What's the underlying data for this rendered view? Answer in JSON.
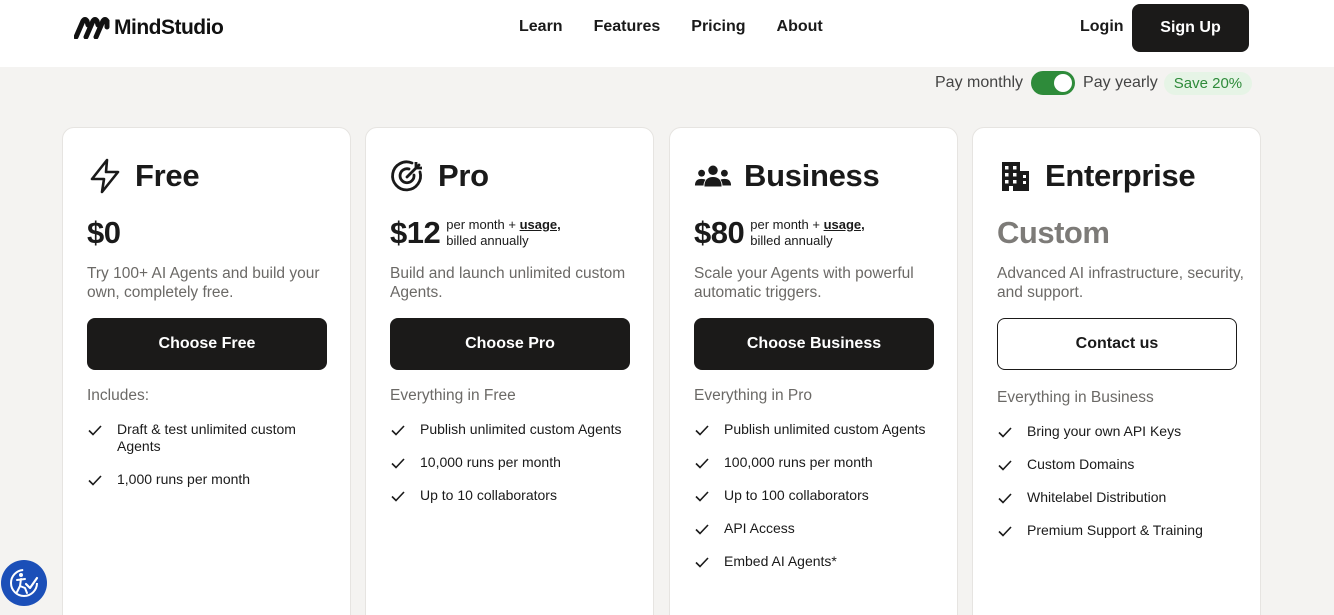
{
  "header": {
    "brand": "MindStudio",
    "nav": [
      "Learn",
      "Features",
      "Pricing",
      "About"
    ],
    "login": "Login",
    "signup": "Sign Up"
  },
  "billing": {
    "monthly": "Pay monthly",
    "yearly": "Pay yearly",
    "save": "Save 20%",
    "yearly_selected": true
  },
  "plans": [
    {
      "name": "Free",
      "icon": "lightning-icon",
      "price": "$0",
      "note_line1": "",
      "note_usage": "",
      "note_line2": "",
      "description": "Try 100+ AI Agents and build your own, completely free.",
      "cta": "Choose Free",
      "includes": "Includes:",
      "features": [
        "Draft & test unlimited custom Agents",
        "1,000 runs per month"
      ]
    },
    {
      "name": "Pro",
      "icon": "target-icon",
      "price": "$12",
      "note_line1": "per month + ",
      "note_usage": "usage,",
      "note_line2": "billed annually",
      "description": "Build and launch unlimited custom Agents.",
      "cta": "Choose Pro",
      "includes": "Everything in Free",
      "features": [
        "Publish unlimited custom Agents",
        "10,000 runs per month",
        "Up to 10 collaborators"
      ]
    },
    {
      "name": "Business",
      "icon": "users-icon",
      "price": "$80",
      "note_line1": "per month + ",
      "note_usage": "usage,",
      "note_line2": "billed annually",
      "description": "Scale your Agents with powerful automatic triggers.",
      "cta": "Choose Business",
      "includes": "Everything in Pro",
      "features": [
        "Publish unlimited custom Agents",
        "100,000 runs per month",
        "Up to 100 collaborators",
        "API Access",
        "Embed AI Agents*"
      ]
    },
    {
      "name": "Enterprise",
      "icon": "building-icon",
      "price": "Custom",
      "note_line1": "",
      "note_usage": "",
      "note_line2": "",
      "description": "Advanced AI infrastructure, security, and support.",
      "cta": "Contact us",
      "includes": "Everything in Business",
      "features": [
        "Bring your own API Keys",
        "Custom Domains",
        "Whitelabel Distribution",
        "Premium Support & Training"
      ]
    }
  ],
  "colors": {
    "accent_dark": "#1b1a19",
    "toggle_green": "#2e8b3a",
    "save_bg": "#e6f4e6",
    "page_bg": "#f4f3f1",
    "a11y_blue": "#1b4fb8"
  }
}
